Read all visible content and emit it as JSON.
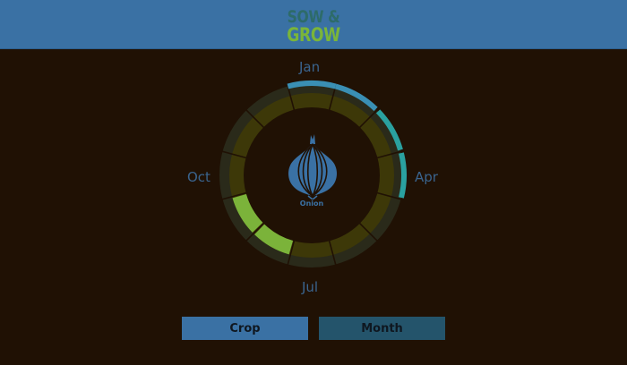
{
  "header": {
    "logo_line1": "SOW &",
    "logo_line2": "GROW"
  },
  "wheel": {
    "months": {
      "top": "Jan",
      "right": "Apr",
      "bottom": "Jul",
      "left": "Oct"
    },
    "crop": {
      "name": "Onion",
      "icon": "onion-icon"
    }
  },
  "buttons": {
    "crop_label": "Crop",
    "month_label": "Month"
  },
  "colors": {
    "header": "#3a71a4",
    "background": "#201104",
    "sow": "#3a8fb4",
    "plant": "#2aa1a0",
    "harvest": "#7bb33a",
    "idle": "#3d3808"
  }
}
